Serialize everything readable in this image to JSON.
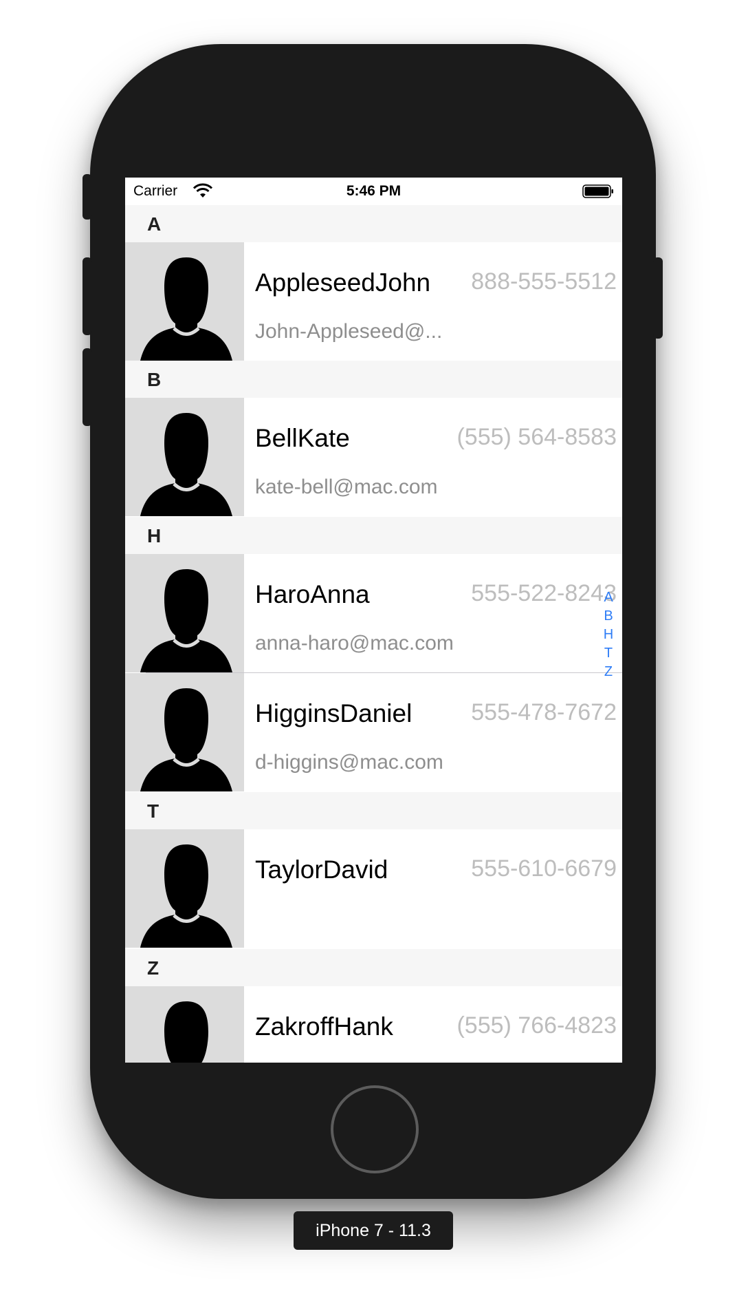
{
  "status_bar": {
    "carrier": "Carrier",
    "time": "5:46 PM",
    "wifi_icon": "wifi-icon",
    "battery_icon": "battery-icon"
  },
  "sections": [
    {
      "letter": "A",
      "contacts": [
        {
          "name": "AppleseedJohn",
          "phone": "888-555-5512",
          "email": "John-Appleseed@..."
        }
      ]
    },
    {
      "letter": "B",
      "contacts": [
        {
          "name": "BellKate",
          "phone": "(555) 564-8583",
          "email": "kate-bell@mac.com"
        }
      ]
    },
    {
      "letter": "H",
      "contacts": [
        {
          "name": "HaroAnna",
          "phone": "555-522-8243",
          "email": "anna-haro@mac.com"
        },
        {
          "name": "HigginsDaniel",
          "phone": "555-478-7672",
          "email": "d-higgins@mac.com"
        }
      ]
    },
    {
      "letter": "T",
      "contacts": [
        {
          "name": "TaylorDavid",
          "phone": "555-610-6679",
          "email": ""
        }
      ]
    },
    {
      "letter": "Z",
      "contacts": [
        {
          "name": "ZakroffHank",
          "phone": "(555) 766-4823",
          "email": ""
        }
      ]
    }
  ],
  "index_bar": [
    "A",
    "B",
    "H",
    "T",
    "Z"
  ],
  "device_label": "iPhone 7 - 11.3",
  "colors": {
    "index_accent": "#2d7cf6",
    "phone_text": "#bdbdbd",
    "email_text": "#8e8e8e",
    "header_background": "#f6f6f6"
  }
}
